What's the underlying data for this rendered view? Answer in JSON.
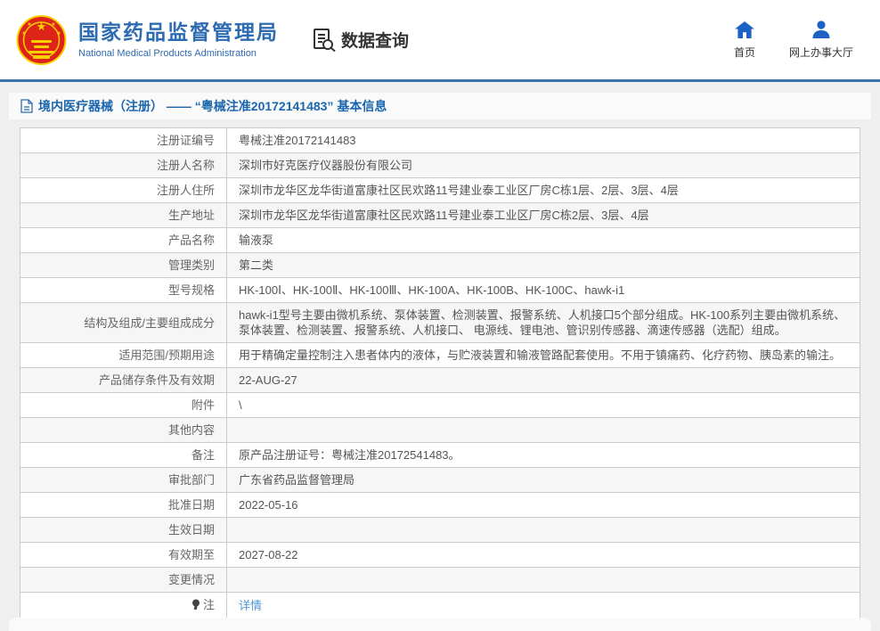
{
  "header": {
    "agency_name_cn": "国家药品监督管理局",
    "agency_name_en": "National Medical Products Administration",
    "section_title": "数据查询",
    "nav": [
      {
        "label": "首页",
        "icon": "home-icon"
      },
      {
        "label": "网上办事大厅",
        "icon": "user-icon"
      }
    ]
  },
  "page": {
    "title": "境内医疗器械（注册） —— “粤械注准20172141483” 基本信息"
  },
  "table": {
    "rows": [
      {
        "label": "注册证编号",
        "value": "粤械注准20172141483"
      },
      {
        "label": "注册人名称",
        "value": "深圳市好克医疗仪器股份有限公司"
      },
      {
        "label": "注册人住所",
        "value": "深圳市龙华区龙华街道富康社区民欢路11号建业泰工业区厂房C栋1层、2层、3层、4层"
      },
      {
        "label": "生产地址",
        "value": "深圳市龙华区龙华街道富康社区民欢路11号建业泰工业区厂房C栋2层、3层、4层"
      },
      {
        "label": "产品名称",
        "value": "输液泵"
      },
      {
        "label": "管理类别",
        "value": "第二类"
      },
      {
        "label": "型号规格",
        "value": "HK-100Ⅰ、HK-100Ⅱ、HK-100Ⅲ、HK-100A、HK-100B、HK-100C、hawk-i1"
      },
      {
        "label": "结构及组成/主要组成成分",
        "value": "hawk-i1型号主要由微机系统、泵体装置、检测装置、报警系统、人机接口5个部分组成。HK-100系列主要由微机系统、泵体装置、检测装置、报警系统、人机接口、 电源线、锂电池、管识别传感器、滴速传感器（选配）组成。"
      },
      {
        "label": "适用范围/预期用途",
        "value": "用于精确定量控制注入患者体内的液体，与贮液装置和输液管路配套使用。不用于镇痛药、化疗药物、胰岛素的输注。"
      },
      {
        "label": "产品储存条件及有效期",
        "value": "22-AUG-27"
      },
      {
        "label": "附件",
        "value": "\\"
      },
      {
        "label": "其他内容",
        "value": ""
      },
      {
        "label": "备注",
        "value": "原产品注册证号：粤械注准20172541483。"
      },
      {
        "label": "审批部门",
        "value": "广东省药品监督管理局"
      },
      {
        "label": "批准日期",
        "value": "2022-05-16"
      },
      {
        "label": "生效日期",
        "value": ""
      },
      {
        "label": "有效期至",
        "value": "2027-08-22"
      },
      {
        "label": "变更情况",
        "value": ""
      },
      {
        "label": "注",
        "value": "详情",
        "is_link": true,
        "icon": "bulb-icon"
      }
    ]
  },
  "icons": {
    "national-emblem-logo": "PRC national emblem (red & gold)",
    "document-search-icon": "document with magnifier",
    "home-icon": "house",
    "user-icon": "person",
    "document-icon": "page with folded corner",
    "bulb-icon": "dark bulb marker before 注"
  },
  "colors": {
    "brand_blue": "#2d6bb2",
    "header_line_blue": "#3a72ad",
    "title_blue": "#1a66ae",
    "nav_icon_blue": "#1c62c4",
    "link_blue": "#4e97d9",
    "emblem_red": "#de2418",
    "emblem_gold": "#f8d000",
    "page_bg": "#efefef",
    "alt_row_bg": "#f6f6f6",
    "table_border": "#cccccc"
  }
}
